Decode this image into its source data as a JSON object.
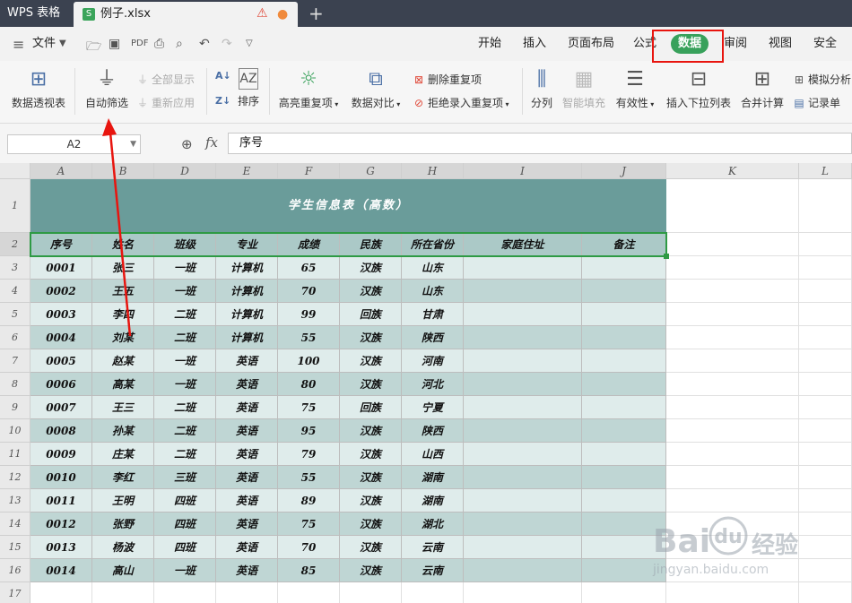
{
  "titlebar": {
    "app_tab": "WPS 表格",
    "file_tab": "例子.xlsx",
    "file_icon": "S",
    "new_tab": "+"
  },
  "menubar": {
    "file_menu": "文件",
    "tabs": [
      "开始",
      "插入",
      "页面布局",
      "公式",
      "数据",
      "审阅",
      "视图",
      "安全"
    ],
    "active_tab": "数据"
  },
  "ribbon": {
    "pivot": "数据透视表",
    "autofilter": "自动筛选",
    "show_all": "全部显示",
    "reapply": "重新应用",
    "sort": "排序",
    "highlight_dup": "高亮重复项",
    "compare": "数据对比",
    "remove_dup": "删除重复项",
    "reject_dup": "拒绝录入重复项",
    "split": "分列",
    "smart_fill": "智能填充",
    "validity": "有效性",
    "insert_dropdown": "插入下拉列表",
    "consolidate": "合并计算",
    "simulate": "模拟分析",
    "record": "记录单"
  },
  "formula_bar": {
    "name_box": "A2",
    "fx": "fx",
    "content": "序号"
  },
  "grid": {
    "columns": [
      "A",
      "B",
      "D",
      "E",
      "F",
      "G",
      "H",
      "I",
      "J",
      "K",
      "L"
    ],
    "rows": [
      "1",
      "2",
      "3",
      "4",
      "5",
      "6",
      "7",
      "8",
      "9",
      "10",
      "11",
      "12",
      "13",
      "14",
      "15",
      "16",
      "17"
    ],
    "title": "学生信息表（高数）",
    "headers": [
      "序号",
      "姓名",
      "班级",
      "专业",
      "成绩",
      "民族",
      "所在省份",
      "家庭住址",
      "备注"
    ],
    "records": [
      [
        "0001",
        "张三",
        "一班",
        "计算机",
        "65",
        "汉族",
        "山东",
        "",
        ""
      ],
      [
        "0002",
        "王五",
        "一班",
        "计算机",
        "70",
        "汉族",
        "山东",
        "",
        ""
      ],
      [
        "0003",
        "李四",
        "二班",
        "计算机",
        "99",
        "回族",
        "甘肃",
        "",
        ""
      ],
      [
        "0004",
        "刘某",
        "二班",
        "计算机",
        "55",
        "汉族",
        "陕西",
        "",
        ""
      ],
      [
        "0005",
        "赵某",
        "一班",
        "英语",
        "100",
        "汉族",
        "河南",
        "",
        ""
      ],
      [
        "0006",
        "高某",
        "一班",
        "英语",
        "80",
        "汉族",
        "河北",
        "",
        ""
      ],
      [
        "0007",
        "王三",
        "二班",
        "英语",
        "75",
        "回族",
        "宁夏",
        "",
        ""
      ],
      [
        "0008",
        "孙某",
        "二班",
        "英语",
        "95",
        "汉族",
        "陕西",
        "",
        ""
      ],
      [
        "0009",
        "庄某",
        "二班",
        "英语",
        "79",
        "汉族",
        "山西",
        "",
        ""
      ],
      [
        "0010",
        "李红",
        "三班",
        "英语",
        "55",
        "汉族",
        "湖南",
        "",
        ""
      ],
      [
        "0011",
        "王明",
        "四班",
        "英语",
        "89",
        "汉族",
        "湖南",
        "",
        ""
      ],
      [
        "0012",
        "张野",
        "四班",
        "英语",
        "75",
        "汉族",
        "湖北",
        "",
        ""
      ],
      [
        "0013",
        "杨波",
        "四班",
        "英语",
        "70",
        "汉族",
        "云南",
        "",
        ""
      ],
      [
        "0014",
        "高山",
        "一班",
        "英语",
        "85",
        "汉族",
        "云南",
        "",
        ""
      ]
    ],
    "row_colors": [
      "#dfeceb",
      "#bfd6d4"
    ],
    "header_color": "#abc9c7",
    "title_color": "#6a9c9a"
  },
  "watermark": {
    "brand": "Bai",
    "brand2": "经验",
    "url": "jingyan.baidu.com"
  }
}
